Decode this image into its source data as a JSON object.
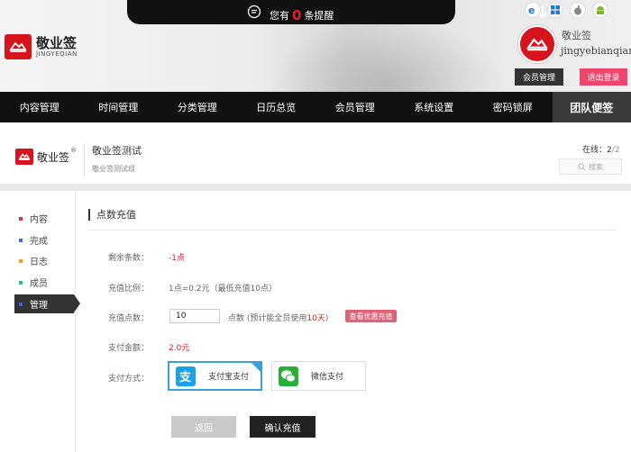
{
  "header": {
    "notice_prefix": "您有",
    "notice_count": "0",
    "notice_suffix": "条提醒",
    "logo_name": "敬业签",
    "logo_sub": "JINGYEQIAN",
    "user_name": "敬业签",
    "user_account": "jingyebianqian",
    "member_btn": "会员管理",
    "logout_btn": "退出登录",
    "os_icons": [
      "ie-icon",
      "windows-icon",
      "apple-icon",
      "android-icon"
    ]
  },
  "nav": {
    "items": [
      "内容管理",
      "时间管理",
      "分类管理",
      "日历总览",
      "会员管理",
      "系统设置",
      "密码锁屏",
      "团队便签"
    ],
    "active_index": 7
  },
  "team": {
    "logo_name": "敬业签",
    "reg": "®",
    "title": "敬业签测试",
    "desc": "敬业签测试组",
    "online_label": "在线：",
    "online_count": "2",
    "online_total": "/2",
    "search_placeholder": "搜索"
  },
  "sidebar": {
    "items": [
      {
        "label": "内容",
        "color": "#e0303a"
      },
      {
        "label": "完成",
        "color": "#3f6ae0"
      },
      {
        "label": "日志",
        "color": "#f0a020"
      },
      {
        "label": "成员",
        "color": "#2cb890"
      },
      {
        "label": "管理",
        "color": "#4060e0"
      }
    ],
    "active_index": 4
  },
  "recharge": {
    "section_title": "点数充值",
    "remaining_label": "剩余条数：",
    "remaining_value": "-1点",
    "ratio_label": "充值比例：",
    "ratio_value": "1点=0.2元（最低充值10点）",
    "qty_label": "充值点数：",
    "qty_value": "10",
    "qty_note_prefix": "点数 (预计能全员使用",
    "qty_note_days": "10天",
    "qty_note_suffix": ")",
    "promo_btn": "查看优惠充值",
    "amount_label": "支付金额：",
    "amount_value": "2.0元",
    "method_label": "支付方式：",
    "alipay_label": "支付宝支付",
    "wechat_label": "微信支付",
    "back_btn": "返回",
    "confirm_btn": "确认充值"
  },
  "colors": {
    "brand_red": "#d7141e",
    "alipay_blue": "#1da1e6",
    "wechat_green": "#2aae3a",
    "selected_border": "#3aa0d8"
  }
}
